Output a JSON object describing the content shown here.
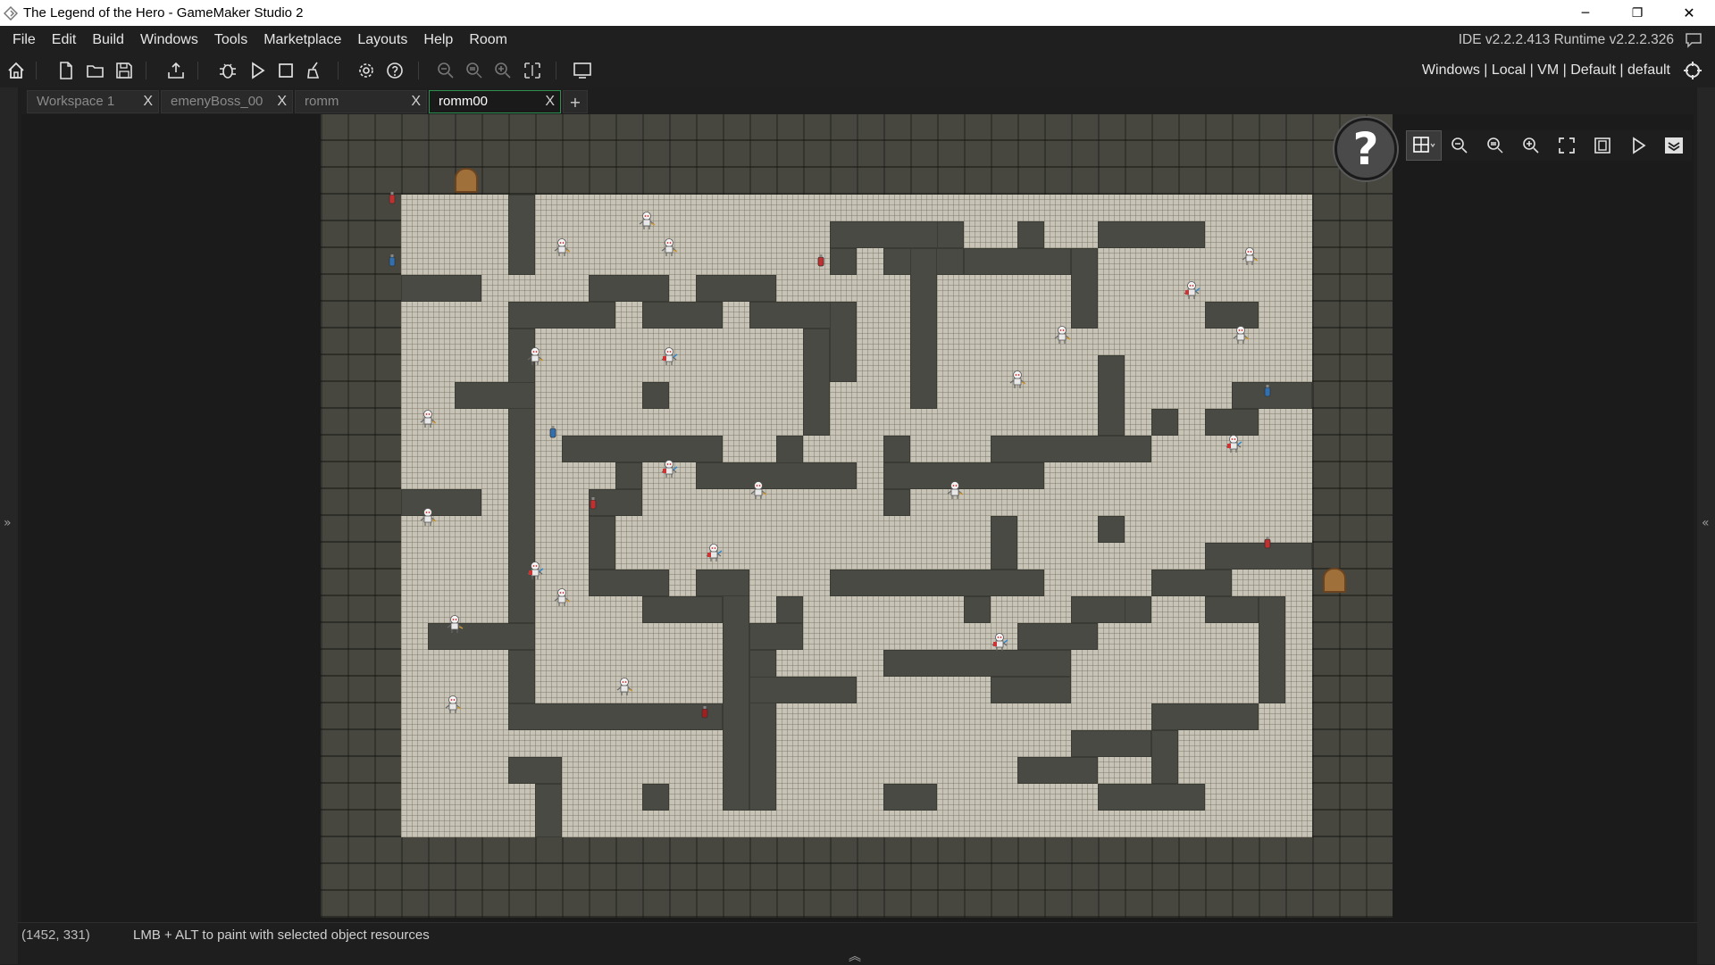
{
  "window": {
    "title": "The Legend of the Hero - GameMaker Studio 2",
    "minimize": "─",
    "restore": "❐",
    "close": "✕"
  },
  "menu": {
    "items": [
      "File",
      "Edit",
      "Build",
      "Windows",
      "Tools",
      "Marketplace",
      "Layouts",
      "Help",
      "Room"
    ],
    "ide_version": "IDE v2.2.2.413  Runtime v2.2.2.326"
  },
  "toolbar": {
    "icons": [
      "home-icon",
      "new-project-icon",
      "open-project-icon",
      "save-project-icon",
      "create-executable-icon",
      "debug-icon",
      "run-icon",
      "stop-icon",
      "clean-icon",
      "game-options-icon",
      "help-icon",
      "zoom-out-icon",
      "zoom-reset-icon",
      "zoom-in-icon",
      "fit-icon",
      "fullscreen-workspace-icon"
    ],
    "target": "Windows | Local | VM | Default | default"
  },
  "tabs": [
    {
      "label": "Workspace 1",
      "close": "X",
      "active": false
    },
    {
      "label": "emenyBoss_00",
      "close": "X",
      "active": false
    },
    {
      "label": "romm",
      "close": "X",
      "active": false
    },
    {
      "label": "romm00",
      "close": "X",
      "active": true
    }
  ],
  "tab_add": "+",
  "room_editor": {
    "help_glyph": "?",
    "tools": [
      "grid-toggle-icon",
      "zoom-out-icon",
      "zoom-reset-icon",
      "zoom-in-icon",
      "fit-room-icon",
      "frame-icon",
      "play-icon",
      "layers-icon"
    ]
  },
  "status": {
    "coords": "(1452, 331)",
    "hint": "LMB + ALT to paint with selected object resources"
  },
  "colors": {
    "accent_tab": "#2f8f4e",
    "room_wall": "#47473f",
    "room_floor": "#c7c3b6"
  }
}
